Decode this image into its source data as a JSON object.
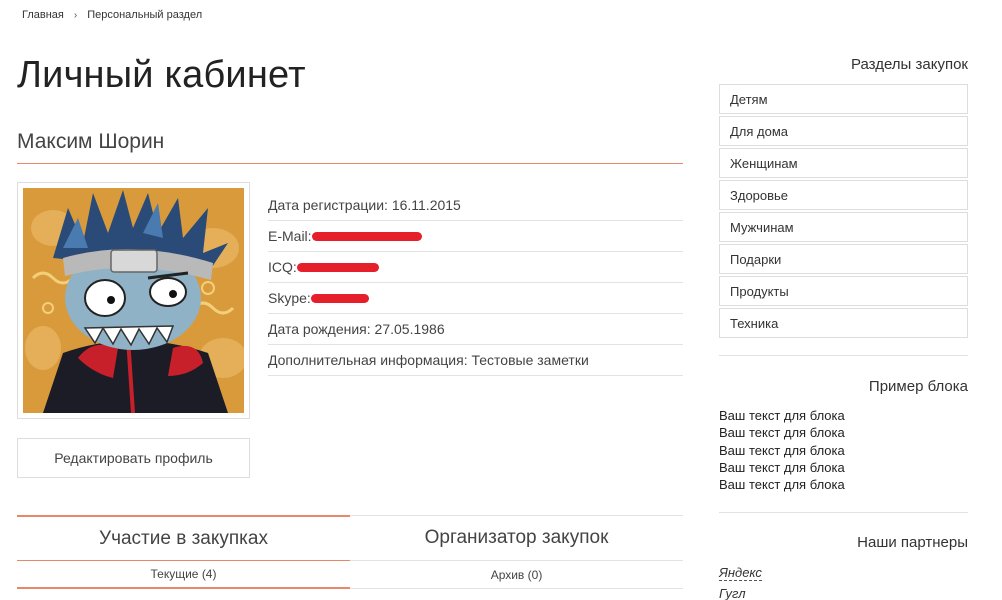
{
  "breadcrumb": {
    "home": "Главная",
    "current": "Персональный раздел"
  },
  "page": {
    "title": "Личный кабинет",
    "user_name": "Максим Шорин"
  },
  "profile": {
    "registration": "Дата регистрации: 16.11.2015",
    "email_label": "E-Mail:",
    "icq_label": "ICQ:",
    "skype_label": "Skype:",
    "birthdate": "Дата рождения: 27.05.1986",
    "additional": "Дополнительная информация: Тестовые заметки",
    "redaction_color": "#e5202a"
  },
  "actions": {
    "edit_profile": "Редактировать профиль"
  },
  "tabs": [
    {
      "label": "Участие в закупках",
      "active": true
    },
    {
      "label": "Организатор закупок",
      "active": false
    }
  ],
  "subtabs": [
    {
      "label": "Текущие (4)",
      "active": true
    },
    {
      "label": "Архив (0)",
      "active": false
    }
  ],
  "sidebar": {
    "categories_title": "Разделы закупок",
    "categories": [
      "Детям",
      "Для дома",
      "Женщинам",
      "Здоровье",
      "Мужчинам",
      "Подарки",
      "Продукты",
      "Техника"
    ],
    "example_title": "Пример блока",
    "example_lines": [
      "Ваш текст для блока",
      "Ваш текст для блока",
      "Ваш текст для блока",
      "Ваш текст для блока",
      "Ваш текст для блока"
    ],
    "partners_title": "Наши партнеры",
    "partners": [
      "Яндекс",
      "Гугл"
    ]
  },
  "colors": {
    "accent": "#e8886a",
    "border": "#dddddd"
  }
}
